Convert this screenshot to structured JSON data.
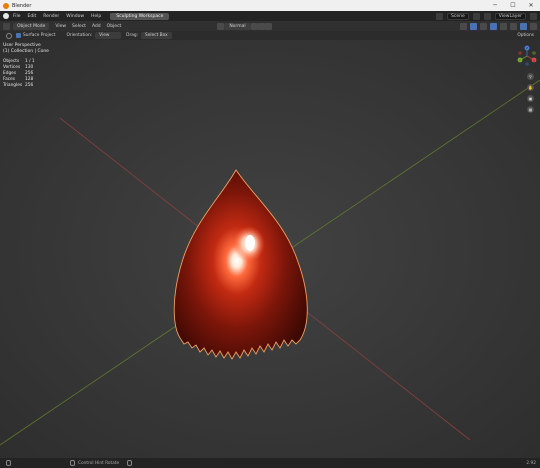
{
  "window": {
    "title": "Blender",
    "min_glyph": "─",
    "max_glyph": "☐",
    "close_glyph": "✕"
  },
  "menu": {
    "items": [
      "File",
      "Edit",
      "Render",
      "Window",
      "Help"
    ],
    "workspace_tab": "Sculpting Workspace",
    "scene_label": "Scene",
    "view_layer_label": "ViewLayer"
  },
  "header": {
    "mode": "Object Mode",
    "menus": [
      "View",
      "Select",
      "Add",
      "Object"
    ],
    "orientation": "Normal"
  },
  "tool_header": {
    "surface_project_label": "Surface Project",
    "orientation_label": "Orientation:",
    "orientation_value": "View",
    "drag_label": "Drag:",
    "drag_value": "Select Box",
    "options_label": "Options"
  },
  "viewport": {
    "perspective": "User Perspective",
    "collection": "(1) Collection | Cone",
    "stats": [
      {
        "key": "Objects",
        "value": "1 / 1"
      },
      {
        "key": "Vertices",
        "value": "130"
      },
      {
        "key": "Edges",
        "value": "256"
      },
      {
        "key": "Faces",
        "value": "128"
      },
      {
        "key": "Triangles",
        "value": "256"
      }
    ],
    "gizmo": {
      "x": "X",
      "y": "Y",
      "z": "Z"
    }
  },
  "status": {
    "hint_1": "Control Hint Rotate",
    "version": "2.92"
  },
  "colors": {
    "viewport_bg": "#3a3a3a",
    "object_red": "#b0200f",
    "selection_outline": "#f0a060",
    "axis_x": "#9a4440",
    "axis_y": "#6a8a2a",
    "accent_blue": "#4772b3"
  }
}
